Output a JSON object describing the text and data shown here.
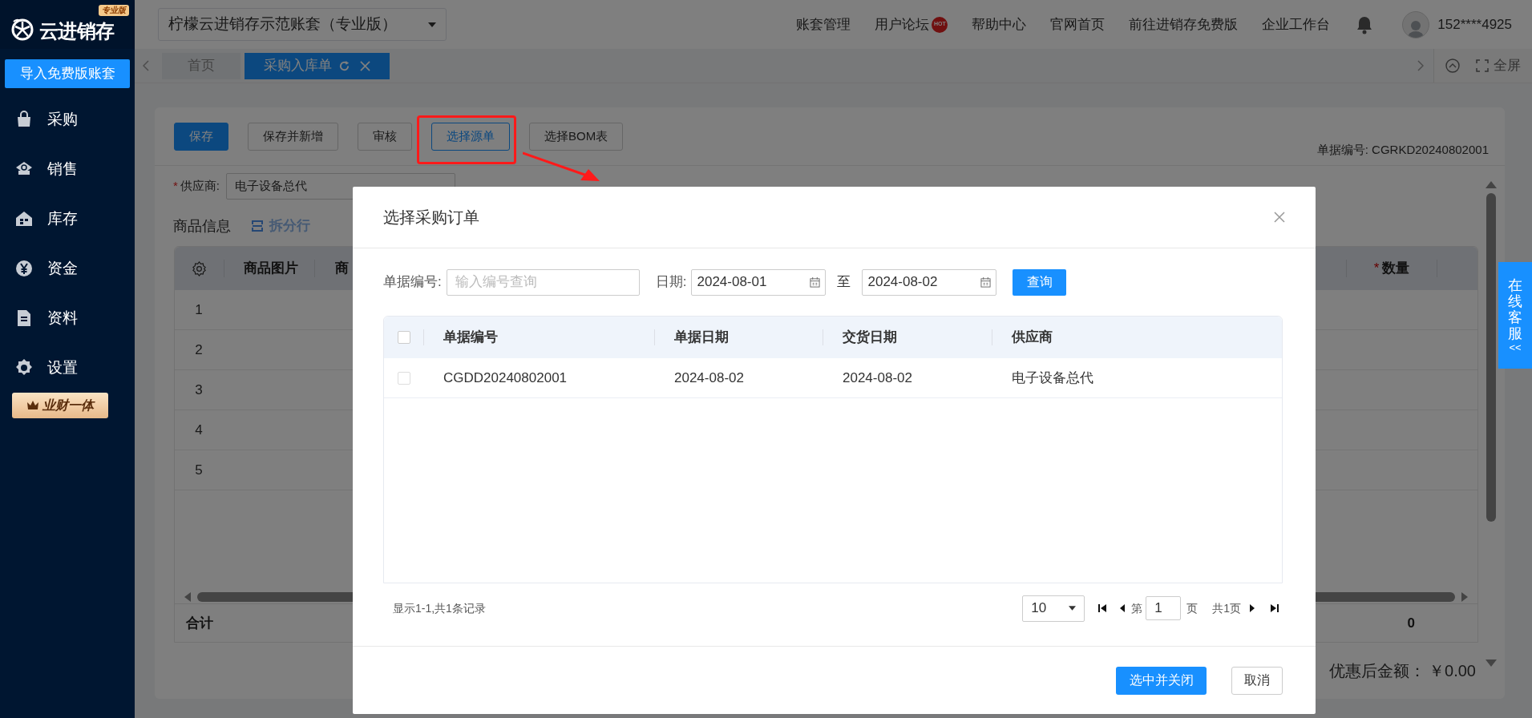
{
  "app": {
    "logo_text": "云进销存",
    "edition_badge": "专业版",
    "import_button": "导入免费版账套"
  },
  "sidebar": {
    "items": [
      {
        "label": "采购"
      },
      {
        "label": "销售"
      },
      {
        "label": "库存"
      },
      {
        "label": "资金"
      },
      {
        "label": "资料"
      },
      {
        "label": "设置"
      }
    ],
    "promo": "业财一体"
  },
  "header": {
    "account": "柠檬云进销存示范账套（专业版）",
    "links": [
      {
        "label": "账套管理"
      },
      {
        "label": "用户论坛",
        "badge": "HOT"
      },
      {
        "label": "帮助中心"
      },
      {
        "label": "官网首页"
      },
      {
        "label": "前往进销存免费版"
      },
      {
        "label": "企业工作台"
      }
    ],
    "user": "152****4925"
  },
  "tabs": {
    "items": [
      {
        "label": "首页",
        "selected": false
      },
      {
        "label": "采购入库单",
        "selected": true
      }
    ],
    "fullscreen": "全屏"
  },
  "toolbar": {
    "buttons": [
      {
        "label": "保存",
        "kind": "primary"
      },
      {
        "label": "保存并新增",
        "kind": "default"
      },
      {
        "label": "审核",
        "kind": "default"
      },
      {
        "label": "选择源单",
        "kind": "highlighted"
      },
      {
        "label": "选择BOM表",
        "kind": "default"
      }
    ],
    "doc_number": "单据编号: CGRKD20240802001"
  },
  "form": {
    "required_mark": "*",
    "supplier_label": "供应商:",
    "supplier_value": "电子设备总代"
  },
  "goods": {
    "title": "商品信息",
    "split_action": "拆分行",
    "columns": [
      {
        "label": "商品图片"
      },
      {
        "label": "商"
      },
      {
        "label": "数量",
        "required_mark": "*"
      }
    ],
    "row_numbers": [
      "1",
      "2",
      "3",
      "4",
      "5"
    ],
    "total_label": "合计",
    "total_qty": "0",
    "discount_label": "优惠后金额：",
    "discount_value": "￥0.00"
  },
  "modal": {
    "title": "选择采购订单",
    "filter": {
      "number_label": "单据编号:",
      "number_placeholder": "输入编号查询",
      "date_label": "日期:",
      "date_from": "2024-08-01",
      "to_label": "至",
      "date_to": "2024-08-02",
      "query_button": "查询"
    },
    "table": {
      "all_checked": false,
      "columns": [
        "单据编号",
        "单据日期",
        "交货日期",
        "供应商"
      ],
      "rows": [
        {
          "checked": false,
          "cells": [
            "CGDD20240802001",
            "2024-08-02",
            "2024-08-02",
            "电子设备总代"
          ]
        }
      ]
    },
    "pagination": {
      "summary": "显示1-1,共1条记录",
      "page_size": "10",
      "page_prefix": "第",
      "page": "1",
      "page_suffix": "页",
      "total_pages": "共1页"
    },
    "buttons": [
      {
        "label": "选中并关闭",
        "kind": "primary"
      },
      {
        "label": "取消",
        "kind": "default"
      }
    ]
  },
  "service_tab": {
    "label": "在线客服",
    "arrow": "<<"
  }
}
